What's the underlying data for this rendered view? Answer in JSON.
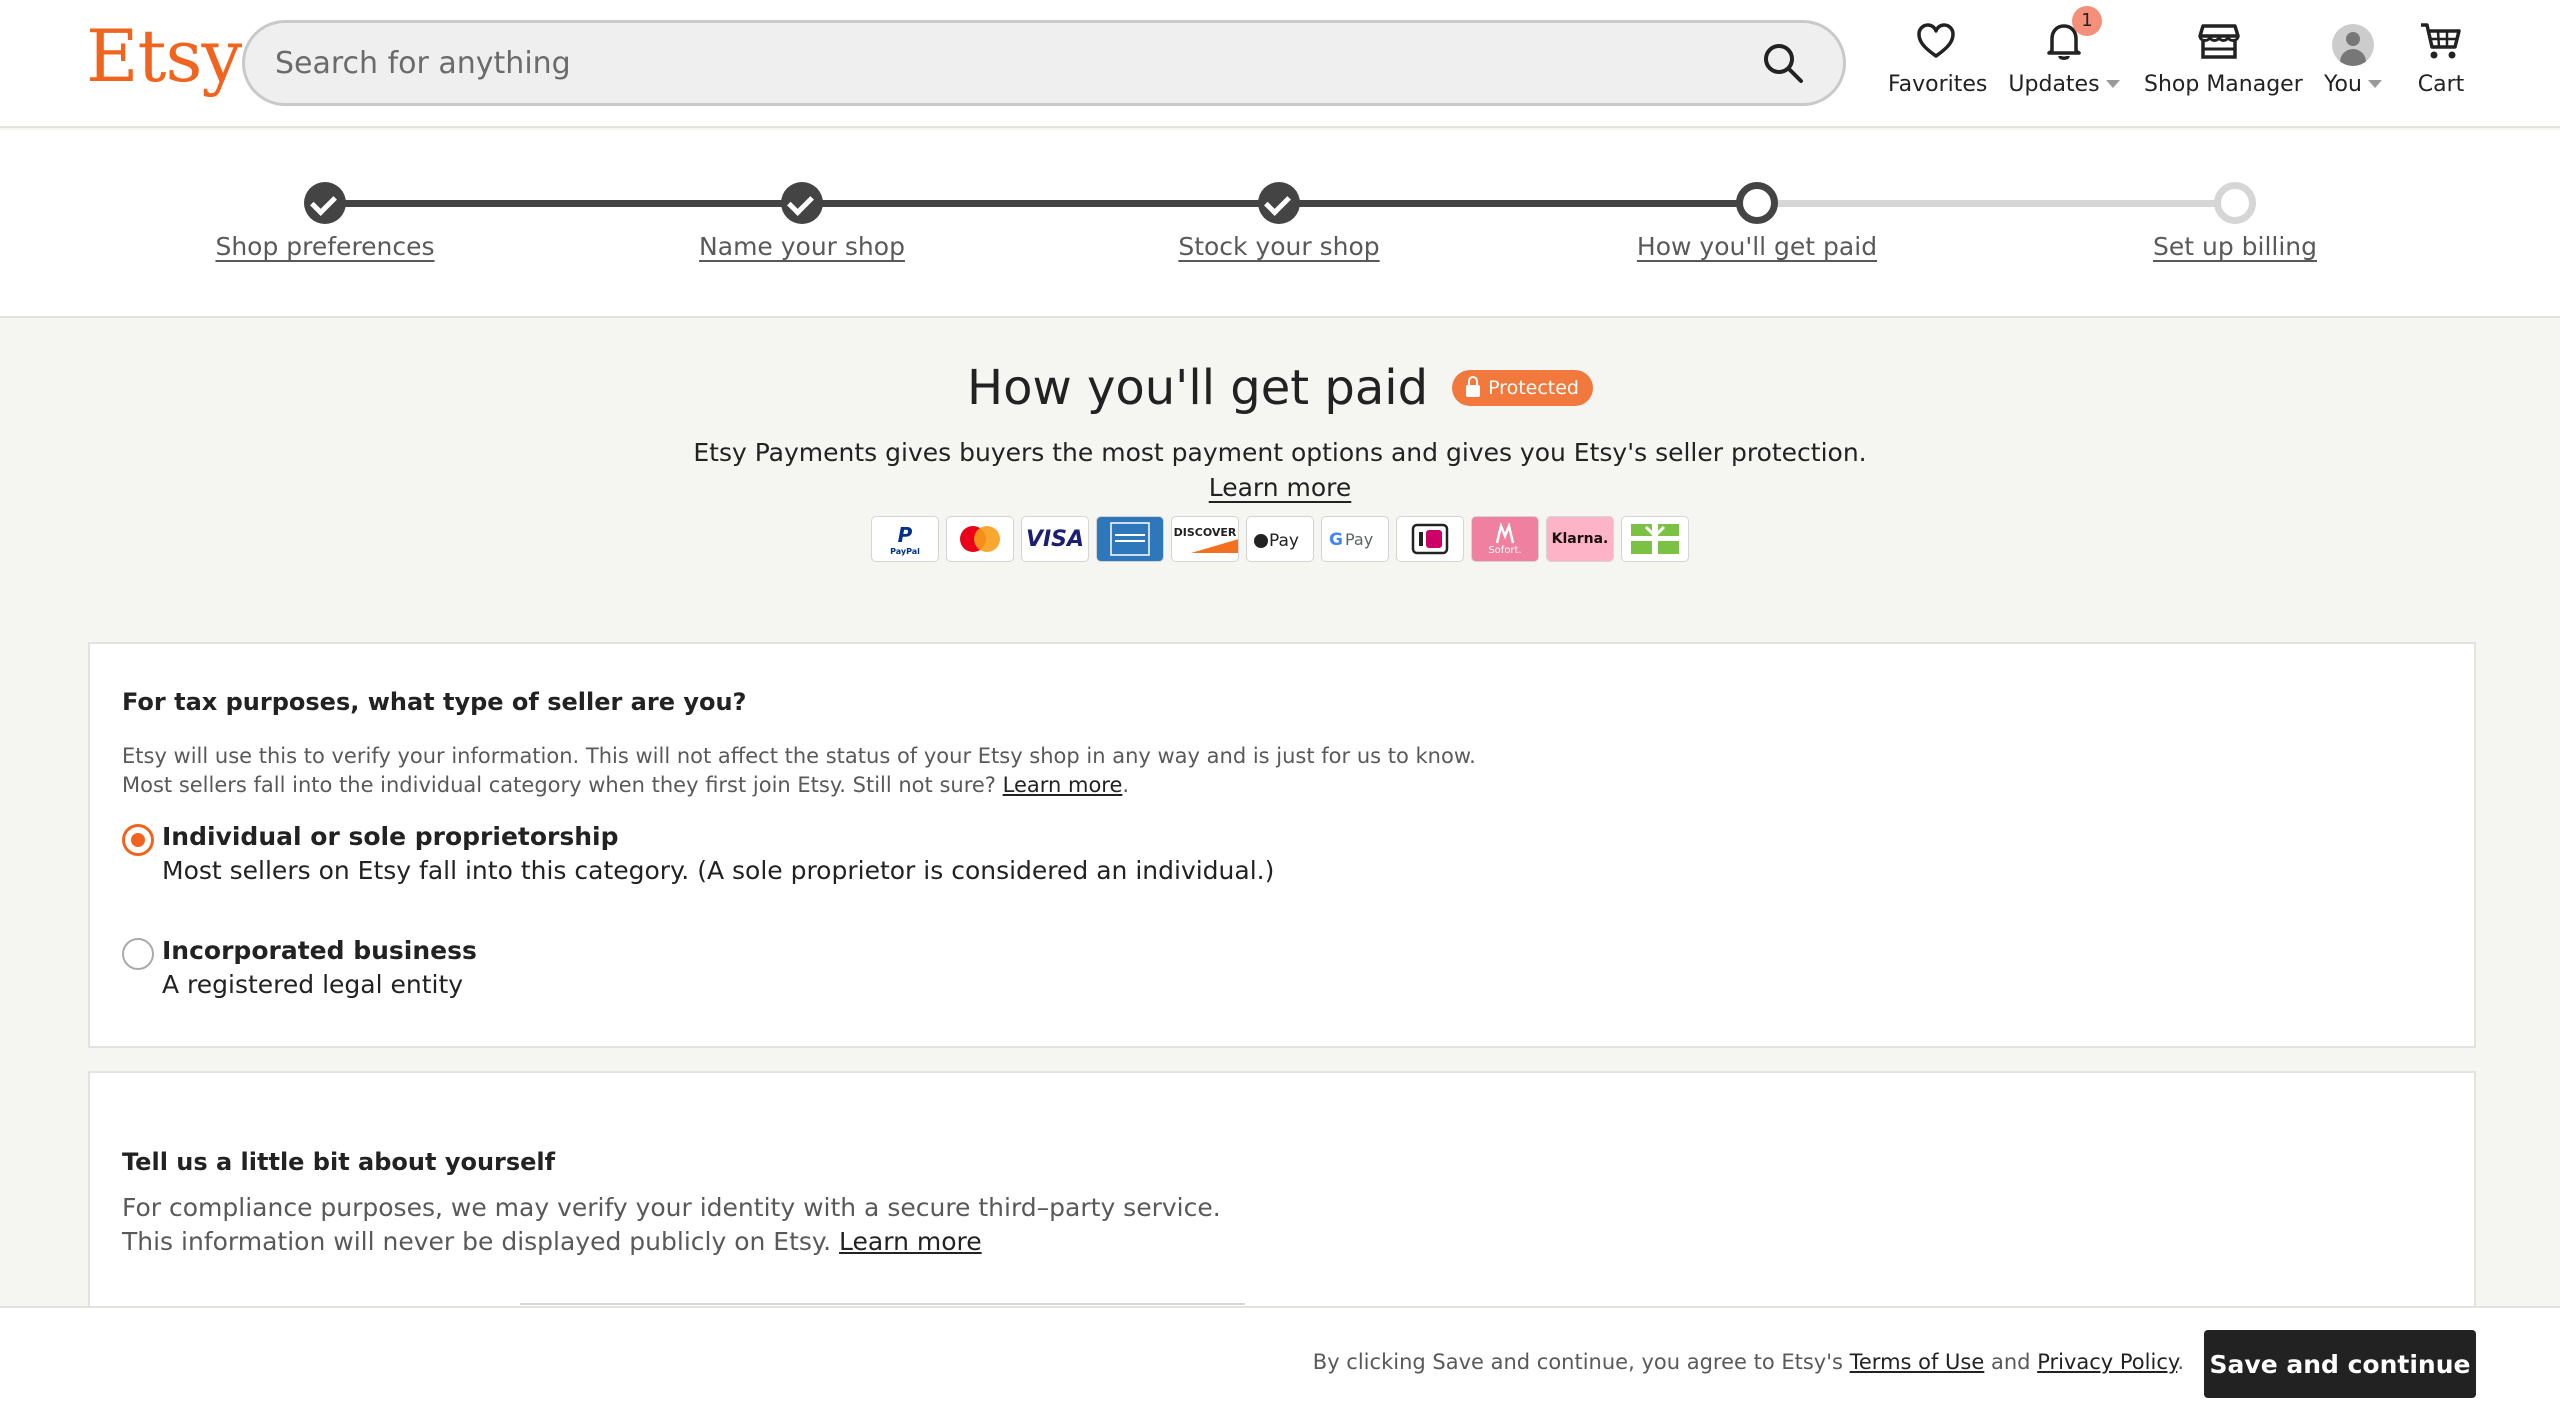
{
  "header": {
    "logo": "Etsy",
    "search_placeholder": "Search for anything",
    "nav": {
      "favorites": "Favorites",
      "updates": "Updates",
      "updates_badge": "1",
      "shop_manager": "Shop Manager",
      "you": "You",
      "cart": "Cart"
    }
  },
  "progress": {
    "steps": [
      {
        "label": "Shop preferences",
        "state": "done"
      },
      {
        "label": "Name your shop",
        "state": "done"
      },
      {
        "label": "Stock your shop",
        "state": "done"
      },
      {
        "label": "How you'll get paid",
        "state": "current"
      },
      {
        "label": "Set up billing",
        "state": "todo"
      }
    ]
  },
  "intro": {
    "title": "How you'll get paid",
    "badge": "Protected",
    "text": "Etsy Payments gives buyers the most payment options and gives you Etsy's seller protection.",
    "learn_more": "Learn more",
    "payment_methods": [
      "PayPal",
      "Mastercard",
      "VISA",
      "American Express",
      "DISCOVER",
      "Apple Pay",
      "G Pay",
      "iDEAL",
      "Sofort",
      "Klarna",
      "Gift card"
    ]
  },
  "seller_type": {
    "question": "For tax purposes, what type of seller are you?",
    "help_line1": "Etsy will use this to verify your information. This will not affect the status of your Etsy shop in any way and is just for us to know.",
    "help_line2": "Most sellers fall into the individual category when they first join Etsy. Still not sure?",
    "help_link": "Learn more",
    "options": [
      {
        "label": "Individual or sole proprietorship",
        "description": "Most sellers on Etsy fall into this category. (A sole proprietor is considered an individual.)",
        "selected": true
      },
      {
        "label": "Incorporated business",
        "description": "A registered legal entity",
        "selected": false
      }
    ]
  },
  "about": {
    "title": "Tell us a little bit about yourself",
    "line1": "For compliance purposes, we may verify your identity with a secure third–party service.",
    "line2": "This information will never be displayed publicly on Etsy.",
    "link": "Learn more"
  },
  "footer": {
    "agree_prefix": "By clicking Save and continue, you agree to Etsy's",
    "terms": "Terms of Use",
    "and": "and",
    "privacy": "Privacy Policy",
    "period": ".",
    "save_button": "Save and continue"
  },
  "colors": {
    "brand": "#f1641e",
    "dark": "#222222"
  }
}
